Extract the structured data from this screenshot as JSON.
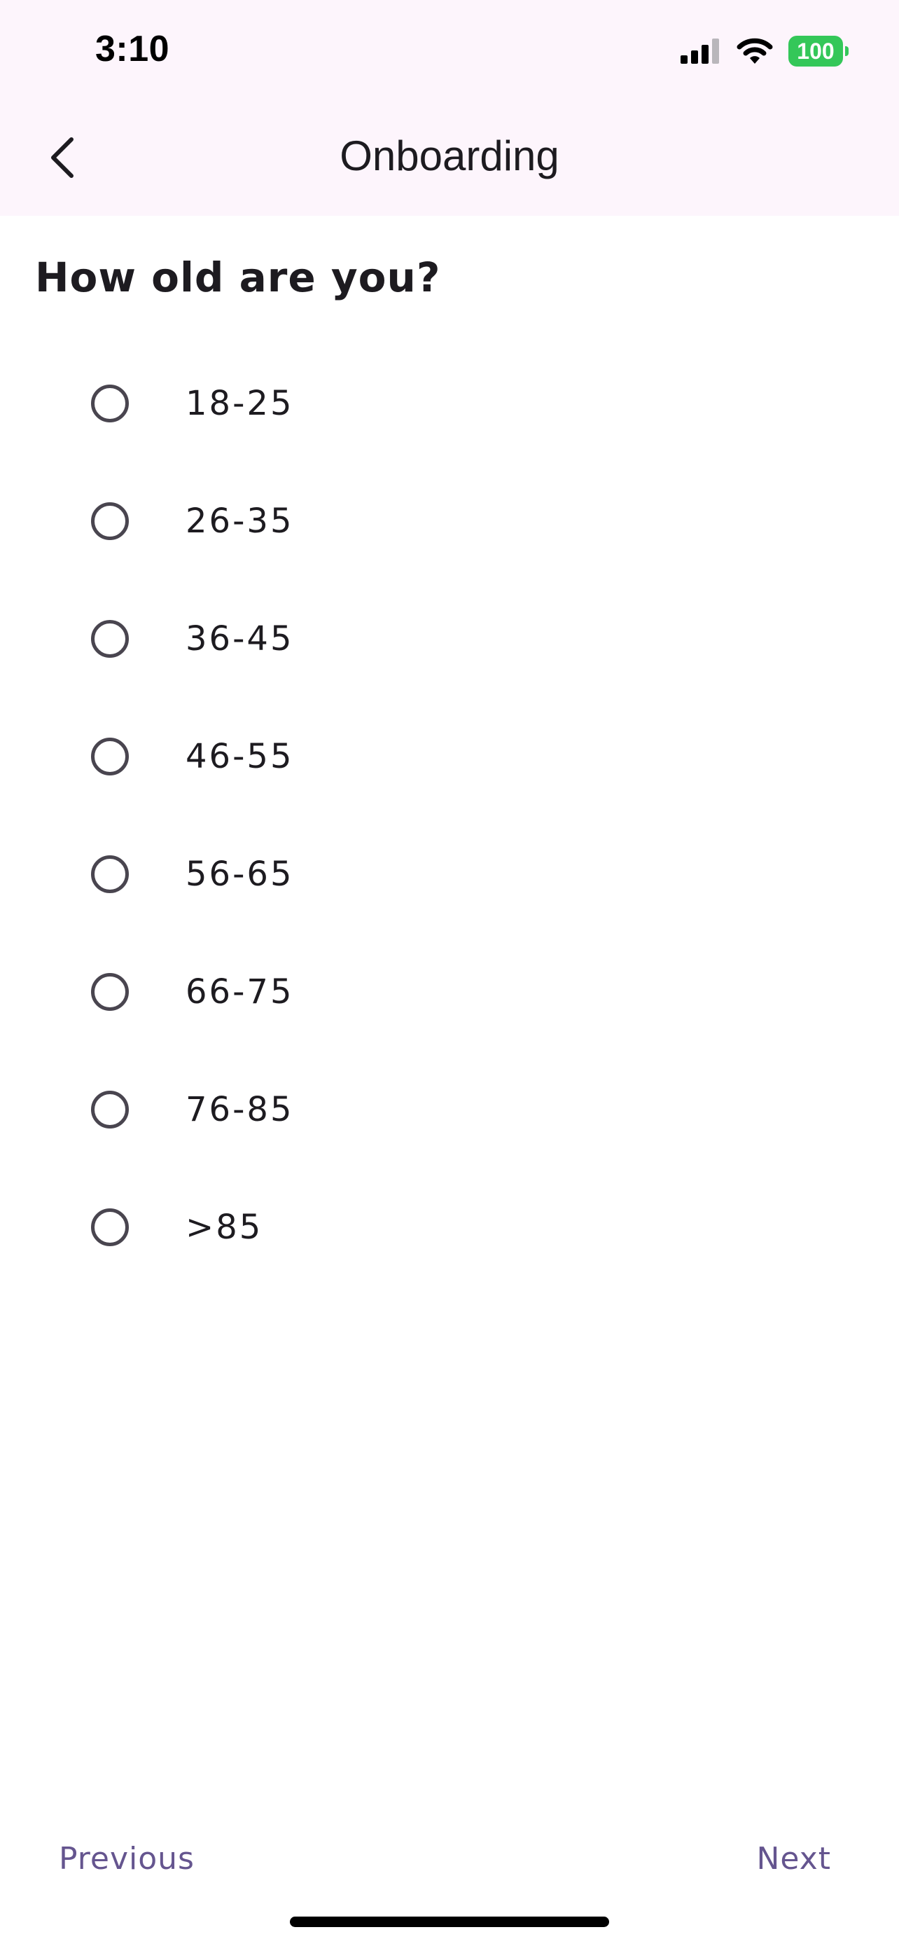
{
  "status_bar": {
    "time": "3:10",
    "battery_level": "100",
    "battery_color": "#34c759",
    "icons": [
      "cellular-signal-icon",
      "wifi-icon",
      "battery-icon"
    ]
  },
  "nav": {
    "title": "Onboarding",
    "back_icon": "chevron-left-icon"
  },
  "question": "How old are you?",
  "options": [
    {
      "label": "18-25",
      "selected": false
    },
    {
      "label": "26-35",
      "selected": false
    },
    {
      "label": "36-45",
      "selected": false
    },
    {
      "label": "46-55",
      "selected": false
    },
    {
      "label": "56-65",
      "selected": false
    },
    {
      "label": "66-75",
      "selected": false
    },
    {
      "label": "76-85",
      "selected": false
    },
    {
      "label": ">85",
      "selected": false
    }
  ],
  "footer": {
    "previous_label": "Previous",
    "next_label": "Next",
    "accent_color": "#65558f"
  },
  "colors": {
    "header_background": "#fdf5fc",
    "text": "#1d1b20",
    "radio_outline": "#49454f"
  }
}
